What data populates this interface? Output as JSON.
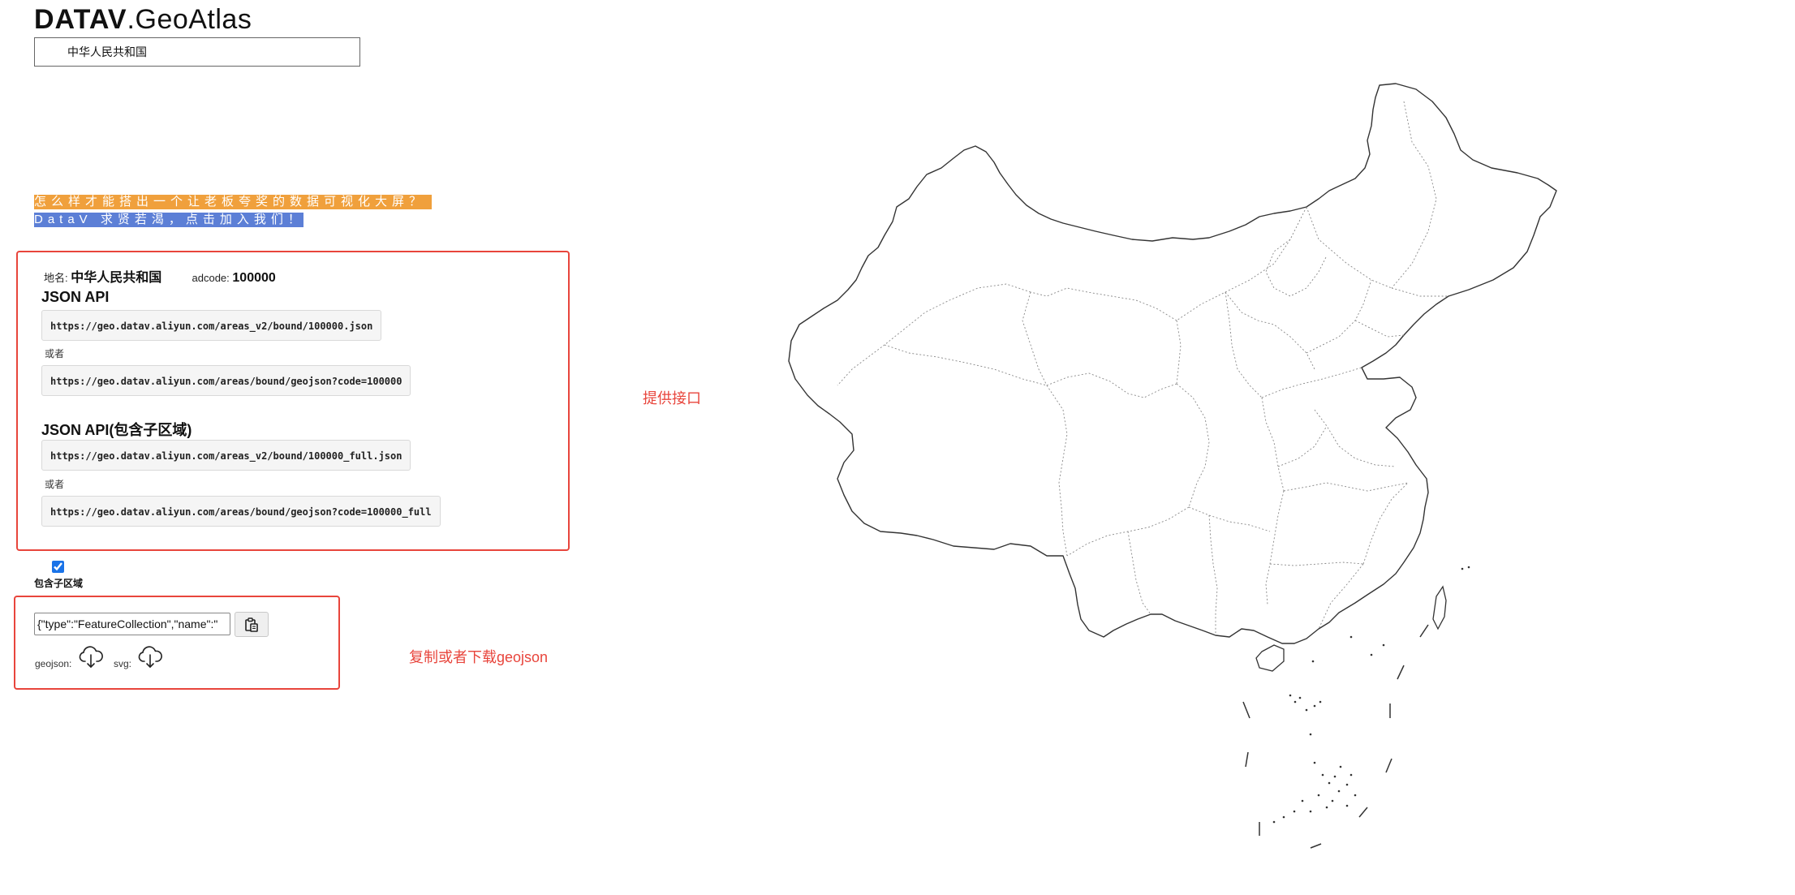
{
  "logo": {
    "bold": "DATAV",
    "light": ".GeoAtlas"
  },
  "search": {
    "value": "中华人民共和国"
  },
  "promo": {
    "line1": "怎么样才能搭出一个让老板夸奖的数据可视化大屏？",
    "line2": "DataV 求贤若渴，点击加入我们！"
  },
  "info": {
    "name_label": "地名:",
    "name_value": "中华人民共和国",
    "adcode_label": "adcode:",
    "adcode_value": "100000"
  },
  "api": {
    "title": "JSON API",
    "url1": "https://geo.datav.aliyun.com/areas_v2/bound/100000.json",
    "or1": "或者",
    "url2": "https://geo.datav.aliyun.com/areas/bound/geojson?code=100000",
    "full_title": "JSON API(包含子区域)",
    "url3": "https://geo.datav.aliyun.com/areas_v2/bound/100000_full.json",
    "or2": "或者",
    "url4": "https://geo.datav.aliyun.com/areas/bound/geojson?code=100000_full"
  },
  "annotations": {
    "provide_api": "提供接口",
    "copy_download": "复制或者下载geojson"
  },
  "subregion": {
    "label": "包含子区域",
    "checked": true
  },
  "geojson": {
    "value": "{\"type\":\"FeatureCollection\",\"name\":\"",
    "label": "geojson:",
    "svg_label": "svg:"
  },
  "icons": {
    "copy": "clipboard-icon",
    "download": "cloud-download-icon"
  }
}
